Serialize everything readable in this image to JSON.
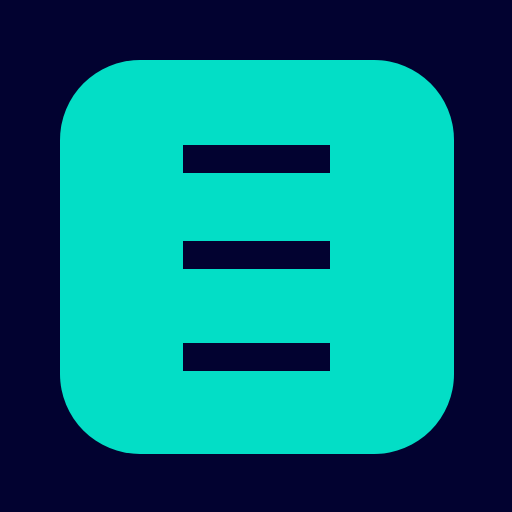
{
  "app": {
    "icon": "hamburger-menu-icon",
    "colors": {
      "background": "#020230",
      "tile": "#03dec6",
      "bars": "#020230"
    }
  }
}
